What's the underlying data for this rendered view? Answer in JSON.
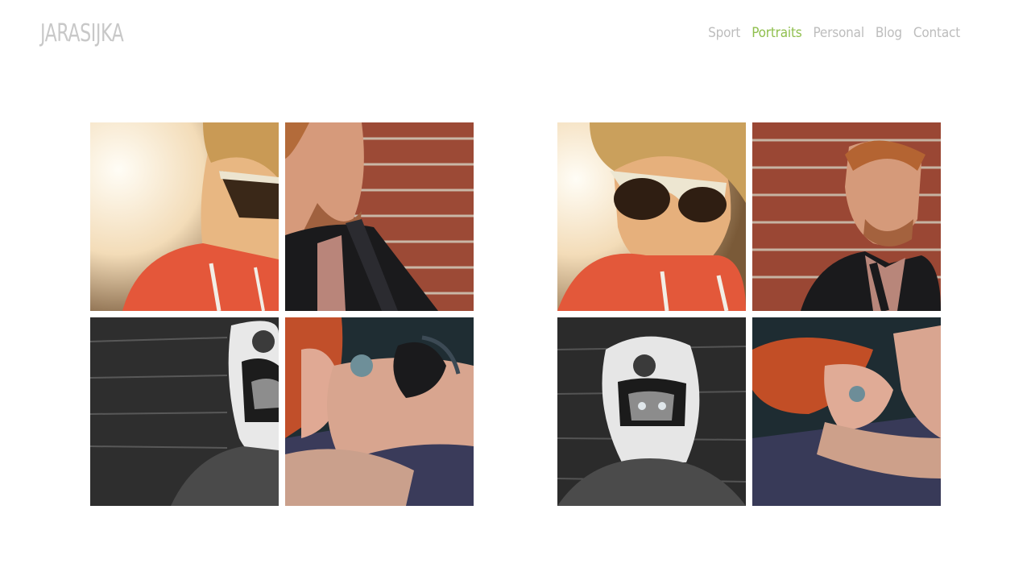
{
  "site": {
    "logo": "JARASIJKA"
  },
  "nav": {
    "items": [
      {
        "label": "Sport",
        "active": false
      },
      {
        "label": "Portraits",
        "active": true
      },
      {
        "label": "Personal",
        "active": false
      },
      {
        "label": "Blog",
        "active": false
      },
      {
        "label": "Contact",
        "active": false
      }
    ]
  },
  "colors": {
    "accent": "#8fbf4d",
    "nav": "#bdbdbd",
    "logo": "#c8c8c8"
  },
  "galleries": [
    {
      "photos": [
        "sunglasses-portrait",
        "brick-wall-man",
        "motocross-helmet",
        "red-hair-woman"
      ]
    },
    {
      "photos": [
        "sunglasses-portrait",
        "brick-wall-man",
        "motocross-helmet",
        "red-hair-woman"
      ]
    }
  ]
}
